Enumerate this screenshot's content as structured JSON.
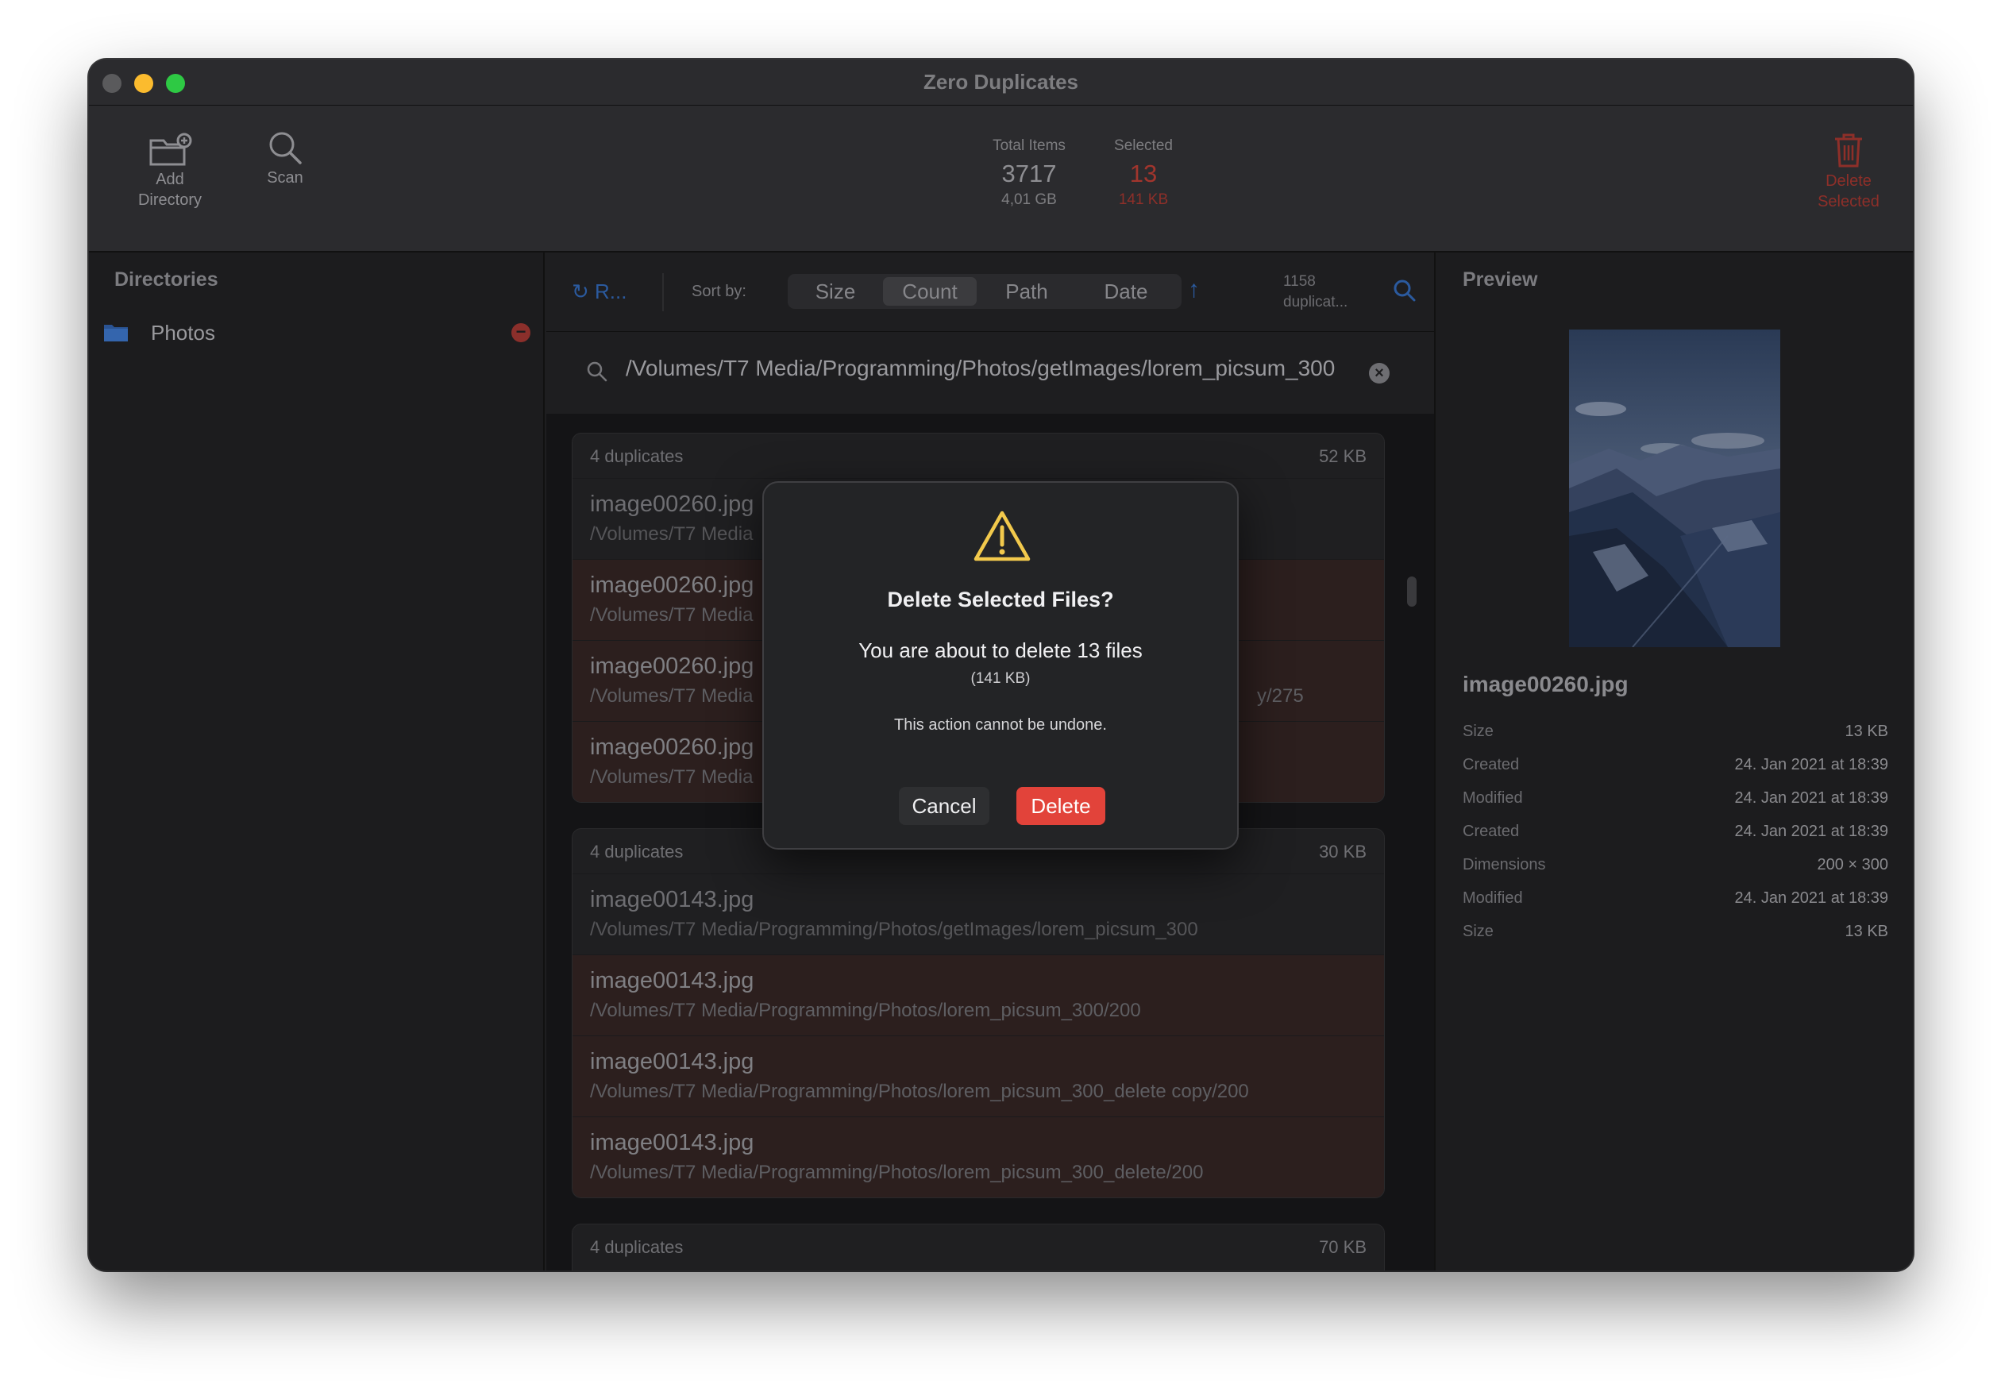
{
  "window": {
    "title": "Zero Duplicates"
  },
  "toolbar": {
    "add_directory_line1": "Add",
    "add_directory_line2": "Directory",
    "scan_label": "Scan",
    "total_items_label": "Total Items",
    "total_items_value": "3717",
    "total_items_size": "4,01 GB",
    "selected_label": "Selected",
    "selected_value": "13",
    "selected_size": "141 KB",
    "delete_selected_line1": "Delete",
    "delete_selected_line2": "Selected"
  },
  "sidebar": {
    "title": "Directories",
    "items": [
      {
        "label": "Photos"
      }
    ]
  },
  "sortbar": {
    "reload_label": "R...",
    "sort_by_label": "Sort by:",
    "options": [
      "Size",
      "Count",
      "Path",
      "Date"
    ],
    "active_option": "Count",
    "duplicates_line1": "1158",
    "duplicates_line2": "duplicat..."
  },
  "search": {
    "value": "/Volumes/T7 Media/Programming/Photos/getImages/lorem_picsum_300"
  },
  "groups": [
    {
      "header": "4 duplicates",
      "size": "52 KB",
      "files": [
        {
          "name": "image00260.jpg",
          "path": "/Volumes/T7 Media",
          "selected": false
        },
        {
          "name": "image00260.jpg",
          "path": "/Volumes/T7 Media",
          "selected": true
        },
        {
          "name": "image00260.jpg",
          "path": "/Volumes/T7 Media",
          "path_tail": "y/275",
          "selected": true
        },
        {
          "name": "image00260.jpg",
          "path": "/Volumes/T7 Media",
          "selected": true
        }
      ]
    },
    {
      "header": "4 duplicates",
      "size": "30 KB",
      "files": [
        {
          "name": "image00143.jpg",
          "path": "/Volumes/T7 Media/Programming/Photos/getImages/lorem_picsum_300",
          "selected": false
        },
        {
          "name": "image00143.jpg",
          "path": "/Volumes/T7 Media/Programming/Photos/lorem_picsum_300/200",
          "selected": true
        },
        {
          "name": "image00143.jpg",
          "path": "/Volumes/T7 Media/Programming/Photos/lorem_picsum_300_delete copy/200",
          "selected": true
        },
        {
          "name": "image00143.jpg",
          "path": "/Volumes/T7 Media/Programming/Photos/lorem_picsum_300_delete/200",
          "selected": true
        }
      ]
    },
    {
      "header": "4 duplicates",
      "size": "70 KB",
      "files": []
    }
  ],
  "preview": {
    "title": "Preview",
    "file_name": "image00260.jpg",
    "meta": [
      {
        "key": "Size",
        "value": "13 KB"
      },
      {
        "key": "Created",
        "value": "24. Jan 2021 at 18:39"
      },
      {
        "key": "Modified",
        "value": "24. Jan 2021 at 18:39"
      },
      {
        "key": "Created",
        "value": "24. Jan 2021 at 18:39"
      },
      {
        "key": "Dimensions",
        "value": "200 × 300"
      },
      {
        "key": "Modified",
        "value": "24. Jan 2021 at 18:39"
      },
      {
        "key": "Size",
        "value": "13 KB"
      }
    ]
  },
  "dialog": {
    "title": "Delete Selected Files?",
    "message": "You are about to delete 13 files",
    "size_note": "(141 KB)",
    "warning": "This action cannot be undone.",
    "cancel_label": "Cancel",
    "delete_label": "Delete"
  },
  "colors": {
    "accent_blue": "#2b5a9e",
    "danger_red": "#c0392b",
    "dialog_delete": "#e2433a",
    "warning_yellow": "#f2c94c"
  }
}
